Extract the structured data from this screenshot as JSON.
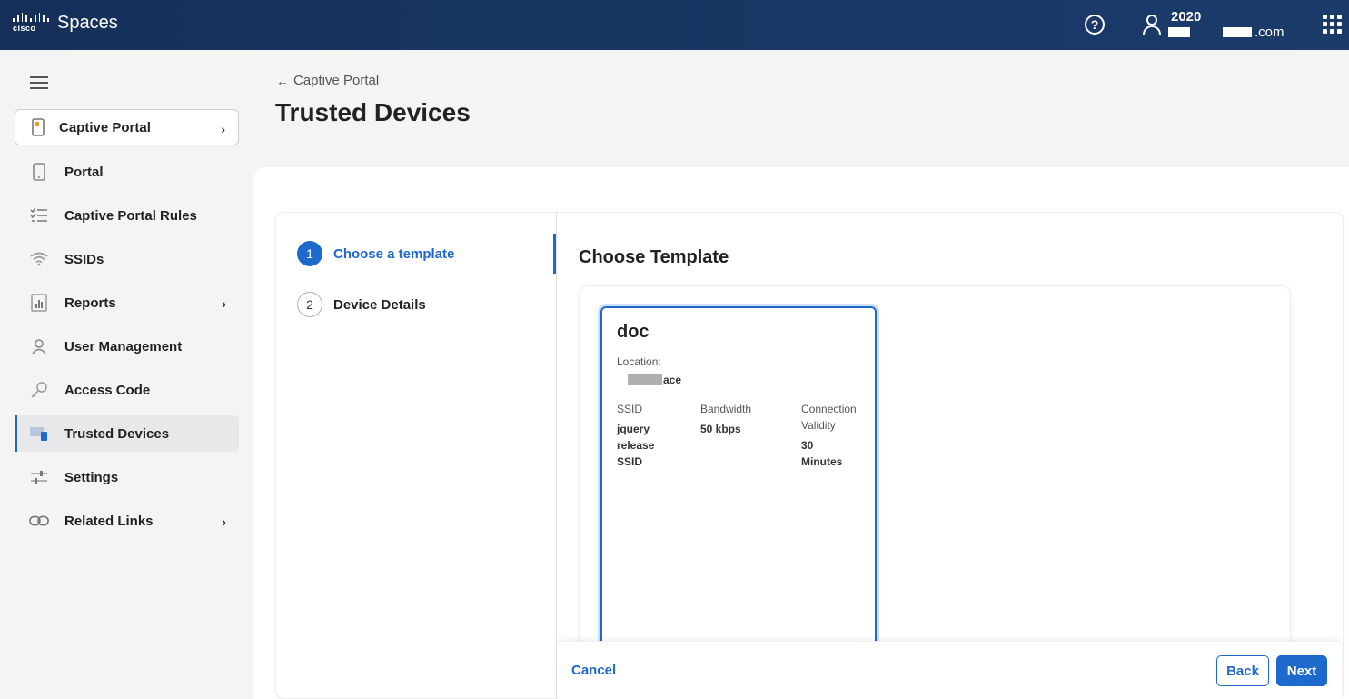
{
  "header": {
    "logo_text": "cisco",
    "app_name": "Spaces",
    "user_name": "2020",
    "user_email_suffix": ".com",
    "colors": {
      "bar": "#1b3b6b",
      "accent": "#1d69cc"
    }
  },
  "breadcrumb": {
    "parent": "Captive Portal"
  },
  "page": {
    "title": "Trusted Devices"
  },
  "sidebar": {
    "parent": {
      "label": "Captive Portal",
      "icon": "captive-portal-icon"
    },
    "items": [
      {
        "label": "Portal",
        "icon": "phone-icon"
      },
      {
        "label": "Captive Portal Rules",
        "icon": "checklist-icon"
      },
      {
        "label": "SSIDs",
        "icon": "wifi-icon"
      },
      {
        "label": "Reports",
        "icon": "bar-chart-icon"
      },
      {
        "label": "User Management",
        "icon": "user-icon"
      },
      {
        "label": "Access Code",
        "icon": "key-icon"
      },
      {
        "label": "Trusted Devices",
        "icon": "devices-icon",
        "active": true
      },
      {
        "label": "Settings",
        "icon": "sliders-icon"
      },
      {
        "label": "Related Links",
        "icon": "link-icon"
      }
    ]
  },
  "wizard": {
    "steps": [
      {
        "num": "1",
        "label": "Choose a template",
        "active": true
      },
      {
        "num": "2",
        "label": "Device Details",
        "active": false
      }
    ],
    "section_title": "Choose Template",
    "template": {
      "name": "doc",
      "location_label": "Location:",
      "location_value_suffix": "ace",
      "ssid_label": "SSID",
      "ssid_value": "jquery release SSID",
      "bandwidth_label": "Bandwidth",
      "bandwidth_value": "50 kbps",
      "validity_label": "Connection Validity",
      "validity_value": "30 Minutes"
    },
    "buttons": {
      "cancel": "Cancel",
      "back": "Back",
      "next": "Next"
    }
  }
}
